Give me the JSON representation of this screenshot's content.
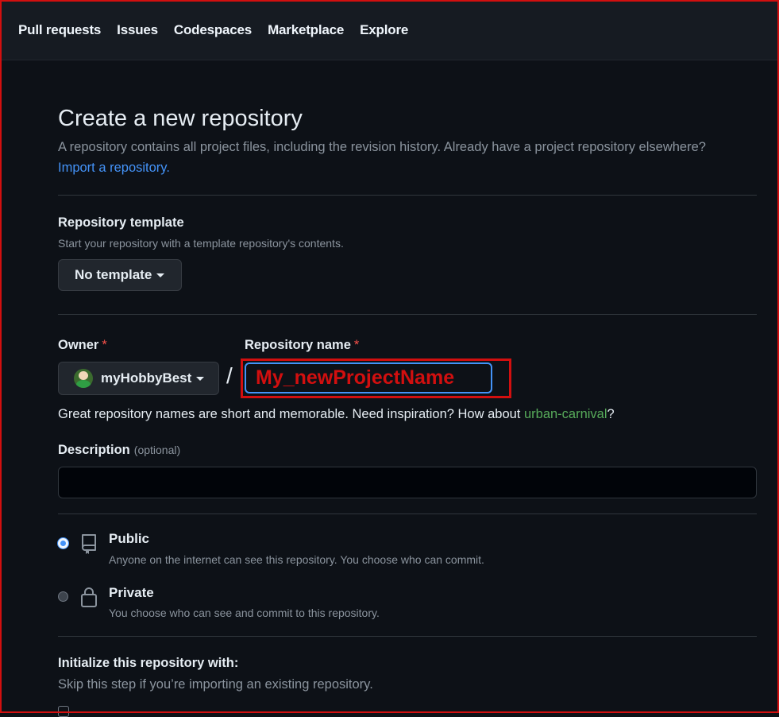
{
  "nav": {
    "items": [
      "Pull requests",
      "Issues",
      "Codespaces",
      "Marketplace",
      "Explore"
    ]
  },
  "page": {
    "title": "Create a new repository",
    "subtitle": "A repository contains all project files, including the revision history. Already have a project repository elsewhere?",
    "import_link": "Import a repository."
  },
  "template": {
    "label": "Repository template",
    "note": "Start your repository with a template repository's contents.",
    "button": "No template"
  },
  "owner": {
    "label": "Owner",
    "required": "*",
    "value": "myHobbyBest"
  },
  "repo": {
    "label": "Repository name",
    "required": "*",
    "separator": "/",
    "value": "My_newProjectName",
    "hint_prefix": "Great repository names are short and memorable. Need inspiration? How about ",
    "suggestion": "urban-carnival",
    "hint_suffix": "?"
  },
  "description": {
    "label": "Description",
    "optional": "(optional)",
    "value": ""
  },
  "visibility": {
    "options": [
      {
        "title": "Public",
        "desc": "Anyone on the internet can see this repository. You choose who can commit.",
        "checked": true,
        "icon": "repo-icon"
      },
      {
        "title": "Private",
        "desc": "You choose who can see and commit to this repository.",
        "checked": false,
        "icon": "lock-icon"
      }
    ]
  },
  "initialize": {
    "label": "Initialize this repository with:",
    "note": "Skip this step if you’re importing an existing repository."
  },
  "colors": {
    "background": "#0d1117",
    "nav_bg": "#161b22",
    "link": "#4493f8",
    "suggestion": "#57ab5a",
    "required": "#f85149",
    "highlight": "#d20f0f"
  }
}
